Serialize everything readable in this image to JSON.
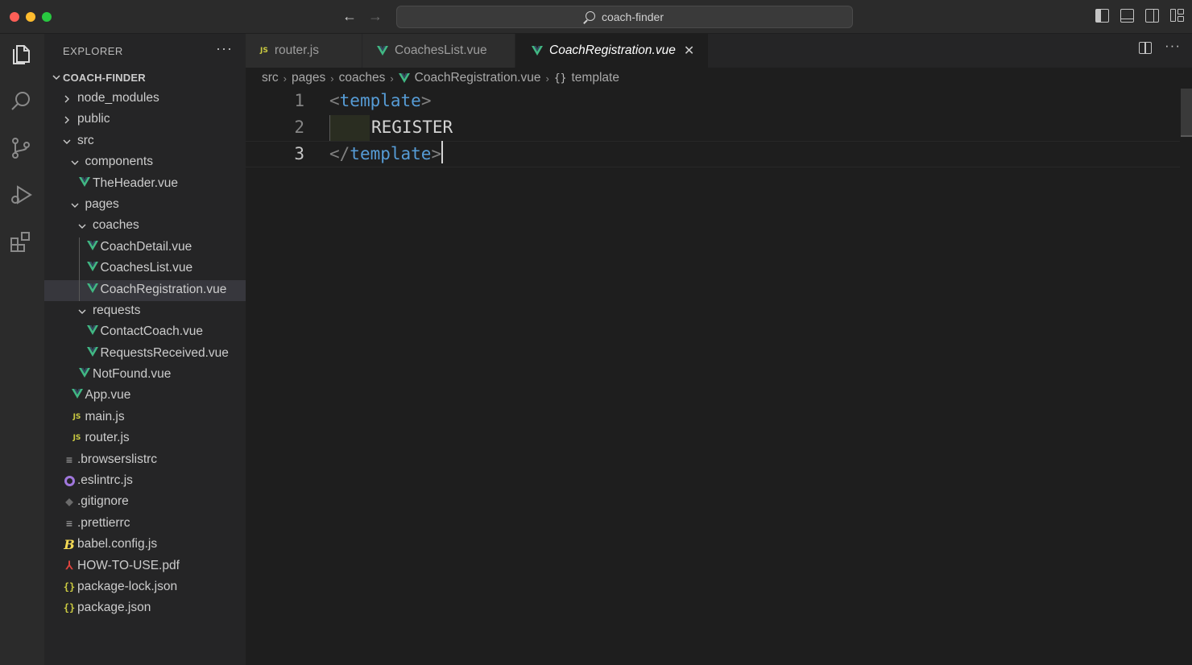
{
  "window": {
    "command_center": "coach-finder"
  },
  "explorer": {
    "header": "EXPLORER",
    "more": "···",
    "root": "COACH-FINDER",
    "items": [
      {
        "label": "node_modules",
        "kind": "folder",
        "expanded": false,
        "depth": 1
      },
      {
        "label": "public",
        "kind": "folder",
        "expanded": false,
        "depth": 1
      },
      {
        "label": "src",
        "kind": "folder",
        "expanded": true,
        "depth": 1
      },
      {
        "label": "components",
        "kind": "folder",
        "expanded": true,
        "depth": 2
      },
      {
        "label": "TheHeader.vue",
        "kind": "vue",
        "depth": 3
      },
      {
        "label": "pages",
        "kind": "folder",
        "expanded": true,
        "depth": 2
      },
      {
        "label": "coaches",
        "kind": "folder",
        "expanded": true,
        "depth": 3
      },
      {
        "label": "CoachDetail.vue",
        "kind": "vue",
        "depth": 4
      },
      {
        "label": "CoachesList.vue",
        "kind": "vue",
        "depth": 4
      },
      {
        "label": "CoachRegistration.vue",
        "kind": "vue",
        "depth": 4,
        "selected": true
      },
      {
        "label": "requests",
        "kind": "folder",
        "expanded": true,
        "depth": 3
      },
      {
        "label": "ContactCoach.vue",
        "kind": "vue",
        "depth": 4
      },
      {
        "label": "RequestsReceived.vue",
        "kind": "vue",
        "depth": 4
      },
      {
        "label": "NotFound.vue",
        "kind": "vue",
        "depth": 3
      },
      {
        "label": "App.vue",
        "kind": "vue",
        "depth": 2
      },
      {
        "label": "main.js",
        "kind": "js",
        "depth": 2
      },
      {
        "label": "router.js",
        "kind": "js",
        "depth": 2
      },
      {
        "label": ".browserslistrc",
        "kind": "lines",
        "depth": 1
      },
      {
        "label": ".eslintrc.js",
        "kind": "eslint",
        "depth": 1
      },
      {
        "label": ".gitignore",
        "kind": "git",
        "depth": 1
      },
      {
        "label": ".prettierrc",
        "kind": "lines",
        "depth": 1
      },
      {
        "label": "babel.config.js",
        "kind": "babel",
        "depth": 1
      },
      {
        "label": "HOW-TO-USE.pdf",
        "kind": "pdf",
        "depth": 1
      },
      {
        "label": "package-lock.json",
        "kind": "json",
        "depth": 1
      },
      {
        "label": "package.json",
        "kind": "json",
        "depth": 1
      }
    ]
  },
  "tabs": [
    {
      "label": "router.js",
      "kind": "js",
      "active": false
    },
    {
      "label": "CoachesList.vue",
      "kind": "vue",
      "active": false
    },
    {
      "label": "CoachRegistration.vue",
      "kind": "vue",
      "active": true
    }
  ],
  "breadcrumbs": {
    "parts": [
      "src",
      "pages",
      "coaches",
      "CoachRegistration.vue",
      "template"
    ],
    "brace": "{}"
  },
  "editor": {
    "lines": [
      {
        "num": "1",
        "open": "<",
        "tag": "template",
        "close": ">",
        "text": ""
      },
      {
        "num": "2",
        "text": "REGISTER"
      },
      {
        "num": "3",
        "open": "</",
        "tag": "template",
        "close": ">",
        "text": ""
      }
    ]
  },
  "colors": {
    "vue_green": "#41b883",
    "vue_dark": "#34495e",
    "tag_blue": "#569cd6",
    "js_yellow": "#cbcb41"
  },
  "icons": {
    "activity": [
      "explorer-icon",
      "search-icon",
      "source-control-icon",
      "run-debug-icon",
      "extensions-icon"
    ],
    "tab_close": "close-icon"
  }
}
